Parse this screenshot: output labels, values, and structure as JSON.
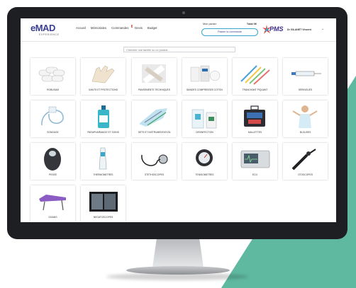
{
  "header": {
    "logo_main": "eMAD",
    "logo_sub": "EXPERIENCE",
    "nav": [
      "Accueil",
      "Mémoriales",
      "Commandes",
      "Devis",
      "Budget"
    ],
    "commandes_badge": "3",
    "cart_label": "Mon panier",
    "cart_total": "Total 0€",
    "cart_button": "Passer la commande",
    "brand": "PMS",
    "user": "Dr GILANET Vincent",
    "caret": "⌄"
  },
  "search": {
    "placeholder": "Chercher une famille ou un produit..."
  },
  "categories": [
    {
      "label": "ROBUSAM",
      "icon": "rolls-icon"
    },
    {
      "label": "GANTS ET PROTECTIONS",
      "icon": "gloves-icon"
    },
    {
      "label": "PANSEMENTS TECHNIQUES",
      "icon": "bandage-icon"
    },
    {
      "label": "BANDES COMPRESSES COTON",
      "icon": "compress-icon"
    },
    {
      "label": "TRANCHANT PIQUANT",
      "icon": "needles-icon"
    },
    {
      "label": "SERINGUES",
      "icon": "syringe-icon"
    },
    {
      "label": "GLYCEMIE",
      "icon": "glucometer-icon"
    },
    {
      "label": "SONDAGE",
      "icon": "catheter-icon"
    },
    {
      "label": "PARAPHARMACIE ET SOINS",
      "icon": "bottle-icon"
    },
    {
      "label": "SETS ET INSTRUMENTATION",
      "icon": "instruments-icon"
    },
    {
      "label": "DESINFECTION",
      "icon": "disinfectant-icon"
    },
    {
      "label": "MALLETTES",
      "icon": "medical-bag-icon"
    },
    {
      "label": "BLOUSES",
      "icon": "nurse-icon"
    },
    {
      "label": "PESEE",
      "icon": "scale-icon"
    },
    {
      "label": "THERMOMETRES",
      "icon": "thermometer-icon"
    },
    {
      "label": "STETHOSCOPES",
      "icon": "stethoscope-icon"
    },
    {
      "label": "TENSIOMETRES",
      "icon": "blood-pressure-icon"
    },
    {
      "label": "ECG",
      "icon": "ecg-icon"
    },
    {
      "label": "OTOSCOPES",
      "icon": "otoscope-icon"
    },
    {
      "label": "DIVANS",
      "icon": "exam-table-icon"
    },
    {
      "label": "NEGATOSCOPES",
      "icon": "xray-viewer-icon"
    }
  ]
}
